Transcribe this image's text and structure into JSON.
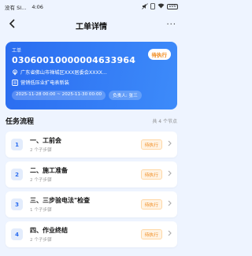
{
  "status_bar": {
    "carrier": "没有 SI...",
    "time": "4:06",
    "battery": "100"
  },
  "header": {
    "title": "工单详情",
    "back_icon": "chevron-left-icon",
    "more_label": "···"
  },
  "order": {
    "label": "工单",
    "number": "0306001000000463396​4",
    "status": "待执行",
    "address": "广东省佛山市禅城区XXX居委会XXXX...",
    "type": "营销低压业扩电表新装",
    "period": "2025-11-28 00:00 ~ 2025-11-30 00:00",
    "owner": "负责人: 张三"
  },
  "section": {
    "title": "任务流程",
    "count": "共 4 个节点"
  },
  "tasks": [
    {
      "num": "1",
      "name": "一、工前会",
      "sub": "2 个子步骤",
      "status": "待执行"
    },
    {
      "num": "2",
      "name": "二、施工准备",
      "sub": "2 个子步骤",
      "status": "待执行"
    },
    {
      "num": "3",
      "name": "三、三步验电法\"检查",
      "sub": "1 个子步骤",
      "status": "待执行"
    },
    {
      "num": "4",
      "name": "四、作业终结",
      "sub": "2 个子步骤",
      "status": "待执行"
    }
  ]
}
